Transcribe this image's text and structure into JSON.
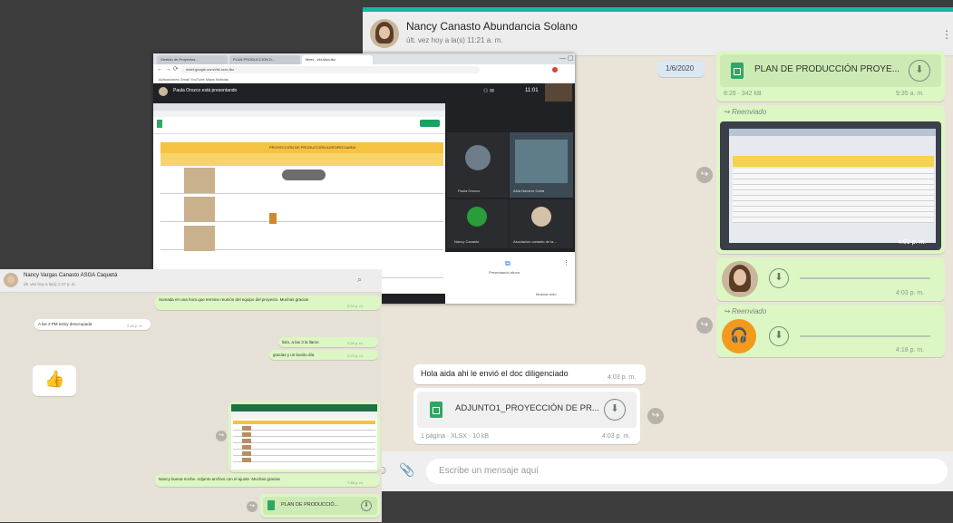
{
  "right_chat": {
    "contact_name": "Nancy Canasto Abundancia Solano",
    "last_seen": "últ. vez hoy a la(s) 11:21 a. m.",
    "date_chip": "1/6/2020",
    "doc1": {
      "name": "PLAN DE PRODUCCIÓN PROYE...",
      "size": "8:26 · 342 kB",
      "time": "9:35 a. m."
    },
    "forwarded_label": "Reenviado",
    "image_time": "4:01 p. m.",
    "audio1_time": "4:03 p. m.",
    "audio2_time": "4:18 p. m.",
    "message_in": {
      "text": "Hola aida ahi le envió el doc diligenciado",
      "time": "4:03 p. m."
    },
    "doc2": {
      "name": "ADJUNTO1_PROYECCIÓN DE PR...",
      "meta": "1 página · XLSX · 10 kB",
      "time": "4:03 p. m."
    },
    "input_placeholder": "Escribe un mensaje aquí",
    "colors": {
      "accent": "#16b7a0",
      "outgoing": "#dcf6c4",
      "audio_orange": "#f39a1e"
    }
  },
  "meet_window": {
    "tabs": [
      "Gestión de Proyectos...",
      "PLAN PRODUCCION D...",
      "Meet - vfd-sfsd-tbz",
      ""
    ],
    "url": "meet.google.com/vfd-xxxx-tbz",
    "bookmarks": "Aplicaciones  Gmail  YouTube  Maps  Noticias",
    "presenting_label": "Paula Orozco está presentando",
    "clock": "11:01",
    "sheet_title": "PROYECCIÓN DE PRODUCCIÓN AGROPECUARIA",
    "participants": [
      {
        "name": "Paula Orozco"
      },
      {
        "name": "Aida Navarro Carta"
      },
      {
        "name": "Nancy Canasto"
      },
      {
        "name": "Asociacion canasto de la..."
      }
    ],
    "present_button": "Presentando ahora",
    "bottom_right": "Mostrar todo"
  },
  "left_chat": {
    "contact_name": "Nancy Vargas Canasto ASGA Caquetá",
    "last_seen": "últ. vez hoy a la(s) 1:47 p. m.",
    "msg1": {
      "text": "Sumada en una hora que termine reunión del equipo del proyecto. Muchas gracias",
      "time": "2:24 p. m."
    },
    "msg2": {
      "text": "A las 3 PM estoy desocupada",
      "time": "2:26 p. m."
    },
    "msg3": {
      "text": "listo, a las 3 la llamo",
      "time": "2:26 p. m."
    },
    "msg4": {
      "text": "gracias y un bonito día",
      "time": "2:27 p. m."
    },
    "sticker": "👍",
    "msg5": {
      "text": "Nancy buena noche. Adjunto archivo con el ajuste. Muchas gracias",
      "time": "7:48 p. m."
    },
    "doc": {
      "name": "PLAN DE PRODUCCIÓ..."
    }
  }
}
